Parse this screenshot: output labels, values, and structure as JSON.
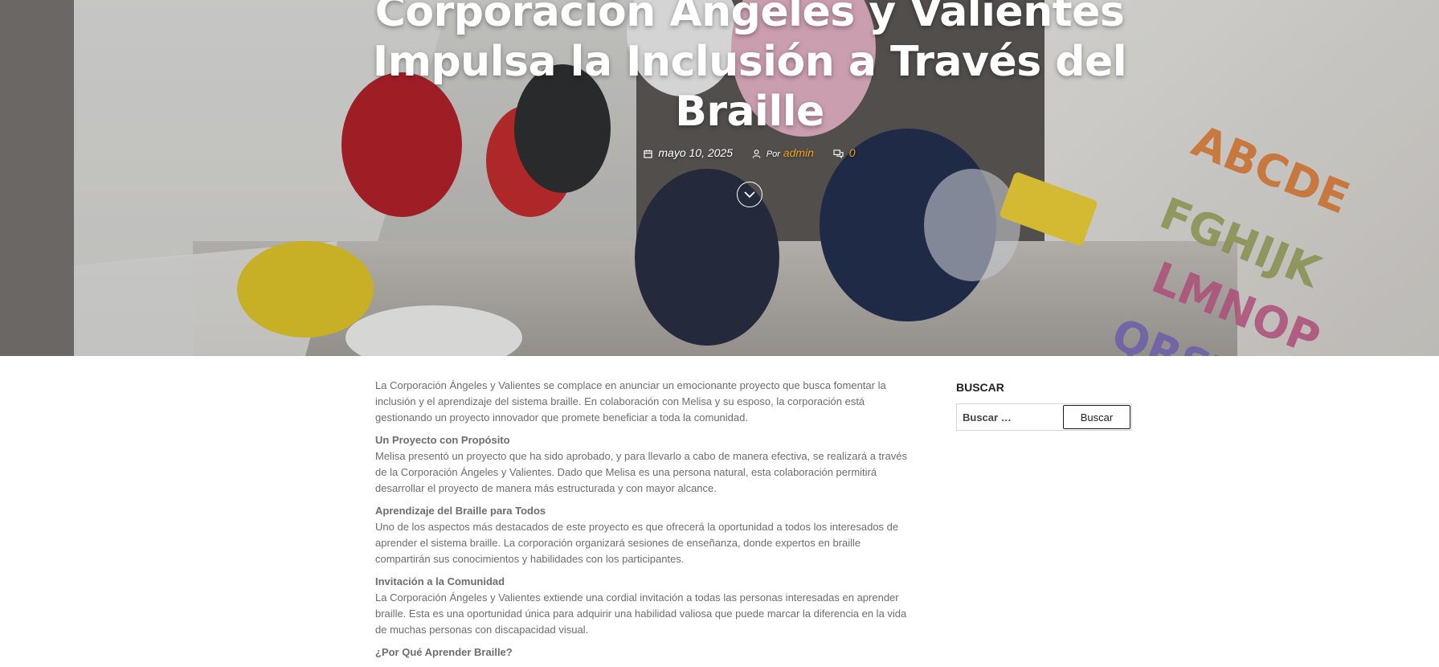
{
  "post": {
    "title": "Corporación Ángeles y Valientes Impulsa la Inclusión a Través del Braille",
    "date": "mayo 10, 2025",
    "by_label": "Por",
    "author": "admin",
    "comments": "0"
  },
  "content": {
    "intro": "La Corporación Ángeles y Valientes se complace en anunciar un emocionante proyecto que busca fomentar la inclusión y el aprendizaje del sistema braille. En colaboración con Melisa y su esposo, la corporación está gestionando un proyecto innovador que promete beneficiar a toda la comunidad.",
    "sections": [
      {
        "heading": "Un Proyecto con Propósito",
        "text": "Melisa presentó un proyecto que ha sido aprobado, y para llevarlo a cabo de manera efectiva, se realizará a través de la Corporación Ángeles y Valientes. Dado que Melisa es una persona natural, esta colaboración permitirá desarrollar el proyecto de manera más estructurada y con mayor alcance."
      },
      {
        "heading": "Aprendizaje del Braille para Todos",
        "text": "Uno de los aspectos más destacados de este proyecto es que ofrecerá la oportunidad a todos los interesados de aprender el sistema braille. La corporación organizará sesiones de enseñanza, donde expertos en braille compartirán sus conocimientos y habilidades con los participantes."
      },
      {
        "heading": "Invitación a la Comunidad",
        "text": "La Corporación Ángeles y Valientes extiende una cordial invitación a todas las personas interesadas en aprender braille. Esta es una oportunidad única para adquirir una habilidad valiosa que puede marcar la diferencia en la vida de muchas personas con discapacidad visual."
      },
      {
        "heading": "¿Por Qué Aprender Braille?",
        "text": ""
      }
    ]
  },
  "sidebar": {
    "search_title": "BUSCAR",
    "search_placeholder": "Buscar …",
    "search_button": "Buscar"
  },
  "colors": {
    "accent": "#f0a21b",
    "body_text": "#6d6d6d",
    "heading_dark": "#222222"
  },
  "icons": {
    "date": "calendar-icon",
    "author": "user-icon",
    "comments": "comments-icon",
    "scroll": "chevron-down-icon"
  }
}
